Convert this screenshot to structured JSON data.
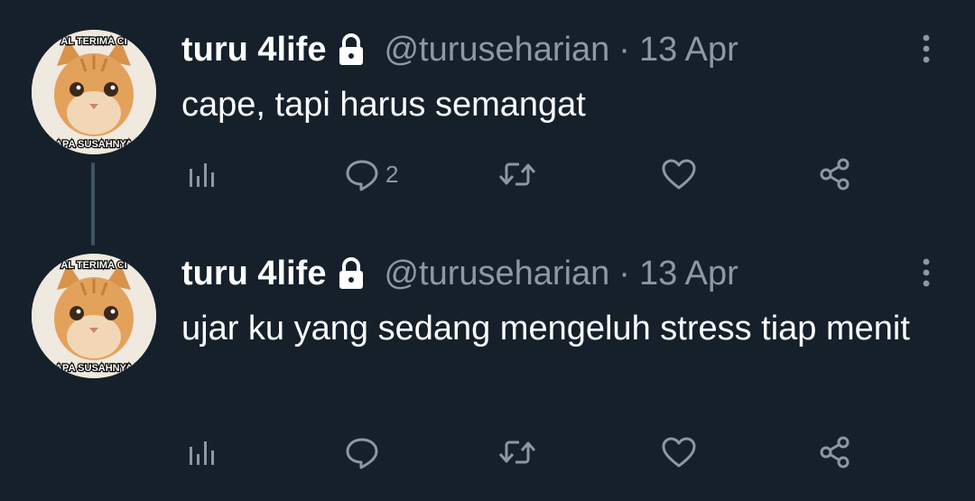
{
  "colors": {
    "background": "#15202b",
    "primary_text": "#ffffff",
    "secondary_text": "#8b98a5",
    "thread_line": "#425364"
  },
  "avatar": {
    "top_caption": "AL TERIMA CI",
    "bottom_caption": "APA SUSAHNYA"
  },
  "tweets": [
    {
      "display_name": "turu 4life",
      "handle": "@turuseharian",
      "separator": "·",
      "timestamp": "13 Apr",
      "text": "cape, tapi harus semangat",
      "reply_count": "2",
      "icons": [
        "analytics-icon",
        "reply-icon",
        "retweet-icon",
        "like-icon",
        "share-icon"
      ]
    },
    {
      "display_name": "turu 4life",
      "handle": "@turuseharian",
      "separator": "·",
      "timestamp": "13 Apr",
      "text": "ujar ku yang sedang mengeluh stress tiap menit",
      "reply_count": "",
      "icons": [
        "analytics-icon",
        "reply-icon",
        "retweet-icon",
        "like-icon",
        "share-icon"
      ]
    }
  ]
}
